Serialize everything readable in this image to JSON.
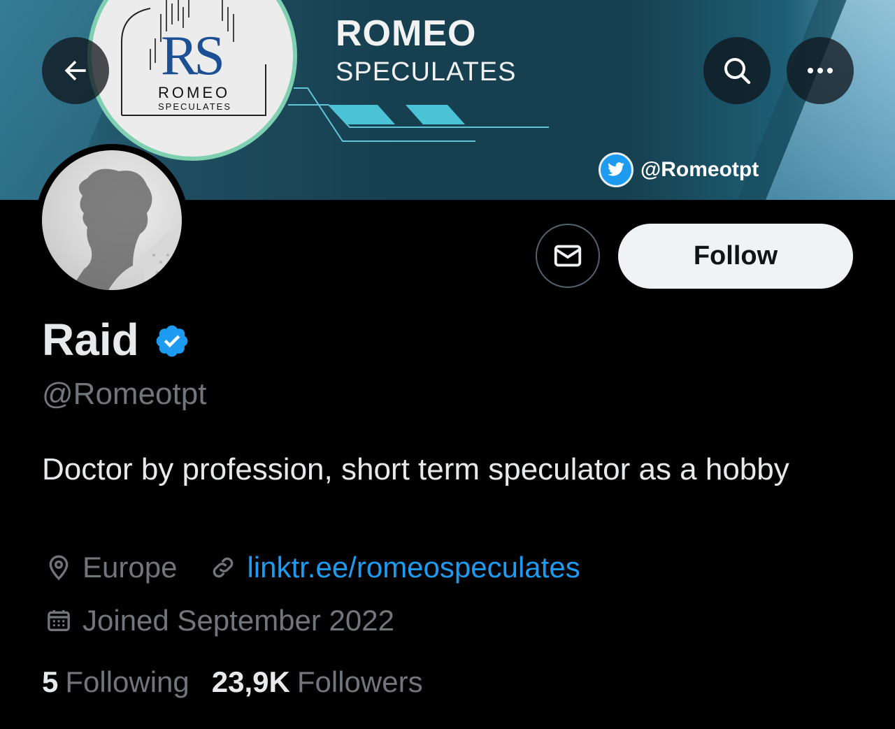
{
  "banner": {
    "brand_title": "ROMEO",
    "brand_subtitle": "SPECULATES",
    "logo_initials": "RS",
    "logo_name": "ROMEO",
    "logo_tagline": "SPECULATES",
    "twitter_handle": "@Romeotpt"
  },
  "nav": {
    "back_icon": "arrow-left-icon",
    "search_icon": "search-icon",
    "more_icon": "more-icon"
  },
  "profile": {
    "display_name": "Raid",
    "handle": "@Romeotpt",
    "bio": "Doctor by profession, short term speculator as a hobby",
    "location": "Europe",
    "website": "linktr.ee/romeospeculates",
    "joined": "Joined September 2022",
    "following_count": "5",
    "following_label": "Following",
    "followers_count": "23,9K",
    "followers_label": "Followers",
    "verified": true
  },
  "actions": {
    "follow_label": "Follow",
    "message_icon": "mail-icon"
  },
  "colors": {
    "accent": "#1d9bf0",
    "background": "#000000",
    "muted": "#71767b",
    "banner": "#163f4f"
  }
}
